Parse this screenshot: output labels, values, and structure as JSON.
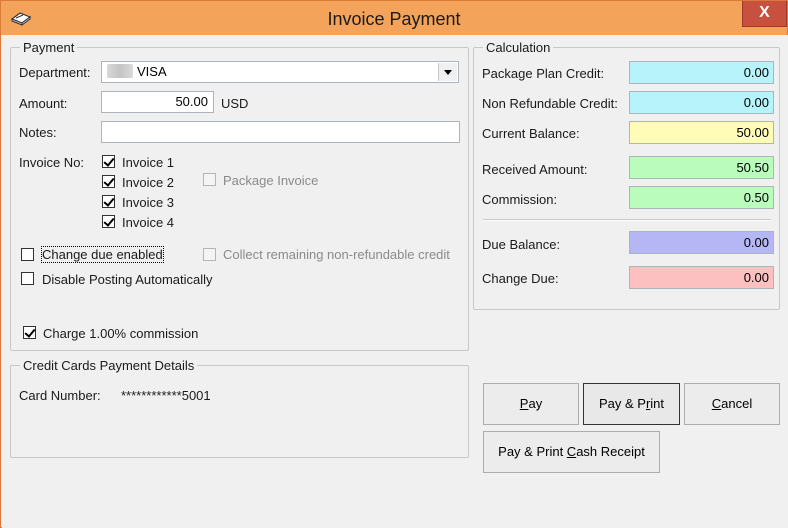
{
  "window": {
    "title": "Invoice Payment",
    "close_label": "X"
  },
  "payment": {
    "legend": "Payment",
    "department_label": "Department:",
    "department_value": "VISA",
    "amount_label": "Amount:",
    "amount_value": "50.00",
    "currency": "USD",
    "notes_label": "Notes:",
    "notes_value": "",
    "invoice_no_label": "Invoice No:",
    "invoices": [
      {
        "label": "Invoice 1",
        "checked": true
      },
      {
        "label": "Invoice 2",
        "checked": true
      },
      {
        "label": "Invoice 3",
        "checked": true
      },
      {
        "label": "Invoice 4",
        "checked": true
      }
    ],
    "package_invoice_label": "Package Invoice",
    "change_due_label": "Change due enabled",
    "collect_label": "Collect remaining non-refundable credit",
    "disable_posting_label": "Disable Posting Automatically",
    "charge_commission_label": "Charge 1.00% commission"
  },
  "card": {
    "legend": "Credit Cards Payment Details",
    "card_number_label": "Card Number:",
    "card_number_value": "************5001"
  },
  "calculation": {
    "legend": "Calculation",
    "package_plan_credit_label": "Package Plan Credit:",
    "package_plan_credit_value": "0.00",
    "non_refundable_credit_label": "Non Refundable Credit:",
    "non_refundable_credit_value": "0.00",
    "current_balance_label": "Current Balance:",
    "current_balance_value": "50.00",
    "received_amount_label": "Received Amount:",
    "received_amount_value": "50.50",
    "commission_label": "Commission:",
    "commission_value": "0.50",
    "due_balance_label": "Due Balance:",
    "due_balance_value": "0.00",
    "change_due_label": "Change Due:",
    "change_due_value": "0.00"
  },
  "colors": {
    "titlebar": "#f3a45a",
    "close_button": "#c7503f",
    "cyan_field": "#b7f3fb",
    "yellow_field": "#fffcb8",
    "green_field": "#b9fcbc",
    "blue_field": "#b5b7f5",
    "red_field": "#fcc0c0"
  },
  "buttons": {
    "pay_mnemonic": "P",
    "pay_rest": "ay",
    "pay_print_pre": "Pay & P",
    "pay_print_mnemonic": "r",
    "pay_print_post": "int",
    "cancel_mnemonic": "C",
    "cancel_rest": "ancel",
    "cash_receipt_pre": "Pay & Print ",
    "cash_receipt_mnemonic": "C",
    "cash_receipt_post": "ash Receipt"
  }
}
